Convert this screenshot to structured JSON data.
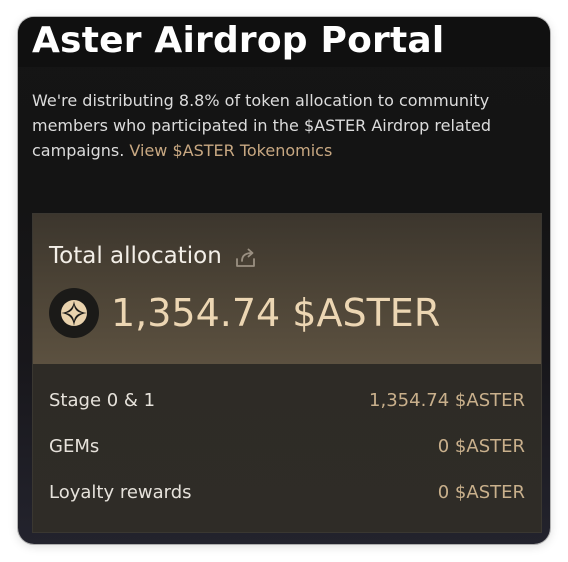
{
  "portal": {
    "title": "Aster Airdrop Portal",
    "description": "We're distributing 8.8% of token allocation to community members who participated in the $ASTER Airdrop related campaigns.",
    "tokenomics_link": "View $ASTER Tokenomics"
  },
  "allocation": {
    "label": "Total allocation",
    "amount": "1,354.74 $ASTER",
    "share_icon": "share-icon",
    "token_icon": "aster-token-icon",
    "rows": [
      {
        "label": "Stage 0 & 1",
        "value": "1,354.74 $ASTER"
      },
      {
        "label": "GEMs",
        "value": "0 $ASTER"
      },
      {
        "label": "Loyalty rewards",
        "value": "0 $ASTER"
      }
    ]
  },
  "colors": {
    "accent": "#c8a882",
    "amount": "#ecd6b3",
    "background": "#141414"
  }
}
